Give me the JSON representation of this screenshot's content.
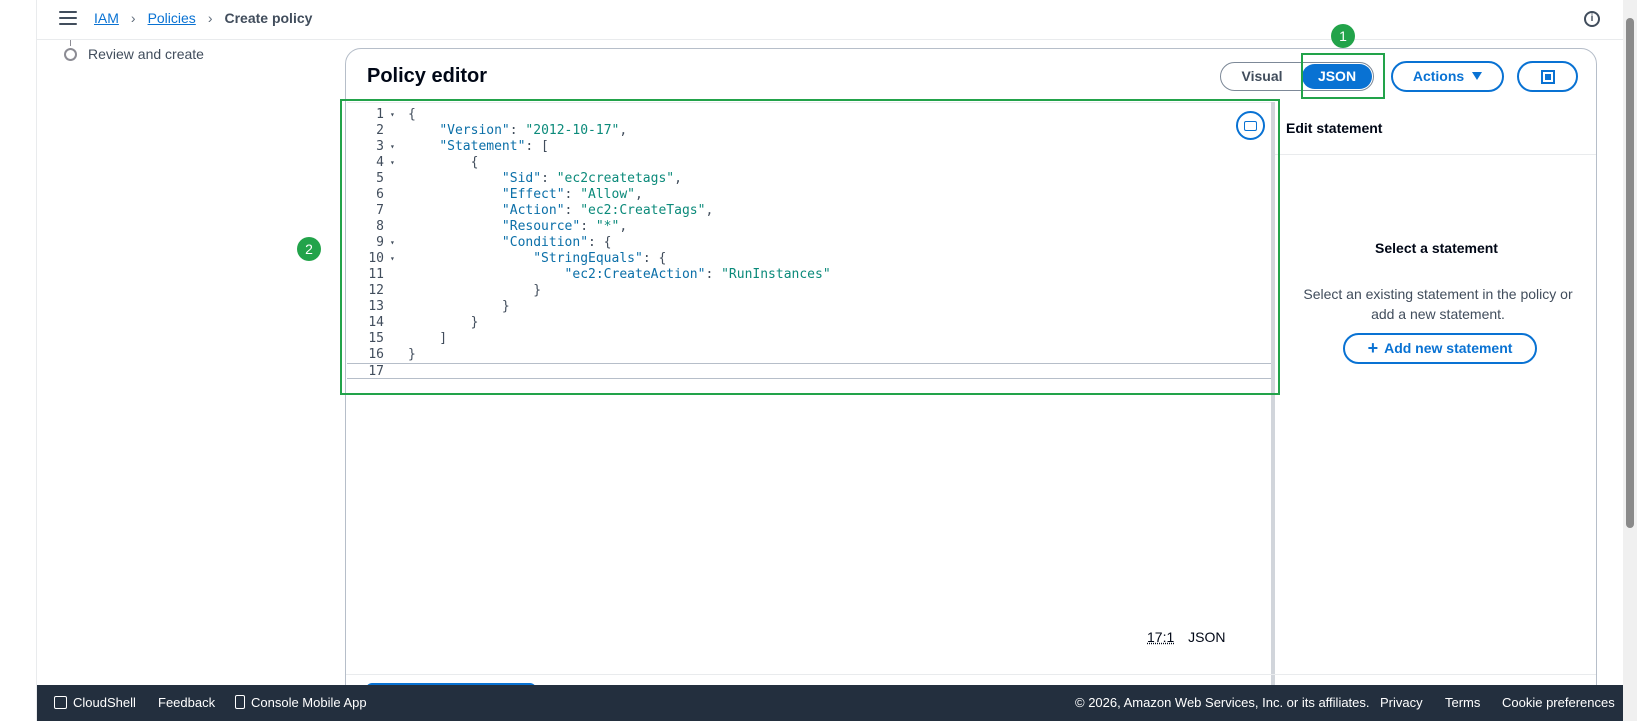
{
  "breadcrumb": {
    "items": [
      "IAM",
      "Policies"
    ],
    "current": "Create policy"
  },
  "wizard": {
    "step_label": "Review and create"
  },
  "editor_panel": {
    "title": "Policy editor",
    "toggle": {
      "visual": "Visual",
      "json": "JSON",
      "selected": "JSON"
    },
    "actions_label": "Actions",
    "status_position": "17:1",
    "status_mode": "JSON"
  },
  "code": [
    {
      "n": "1",
      "fold": true,
      "text": "{"
    },
    {
      "n": "2",
      "fold": false,
      "text": "    \"Version\": \"2012-10-17\","
    },
    {
      "n": "3",
      "fold": true,
      "text": "    \"Statement\": ["
    },
    {
      "n": "4",
      "fold": true,
      "text": "        {"
    },
    {
      "n": "5",
      "fold": false,
      "text": "            \"Sid\": \"ec2createtags\","
    },
    {
      "n": "6",
      "fold": false,
      "text": "            \"Effect\": \"Allow\","
    },
    {
      "n": "7",
      "fold": false,
      "text": "            \"Action\": \"ec2:CreateTags\","
    },
    {
      "n": "8",
      "fold": false,
      "text": "            \"Resource\": \"*\","
    },
    {
      "n": "9",
      "fold": true,
      "text": "            \"Condition\": {"
    },
    {
      "n": "10",
      "fold": true,
      "text": "                \"StringEquals\": {"
    },
    {
      "n": "11",
      "fold": false,
      "text": "                    \"ec2:CreateAction\": \"RunInstances\""
    },
    {
      "n": "12",
      "fold": false,
      "text": "                }"
    },
    {
      "n": "13",
      "fold": false,
      "text": "            }"
    },
    {
      "n": "14",
      "fold": false,
      "text": "        }"
    },
    {
      "n": "15",
      "fold": false,
      "text": "    ]"
    },
    {
      "n": "16",
      "fold": false,
      "text": "}"
    },
    {
      "n": "17",
      "fold": false,
      "text": ""
    }
  ],
  "statement_panel": {
    "title": "Edit statement",
    "empty_title": "Select a statement",
    "empty_desc": "Select an existing statement in the policy or add a new statement.",
    "add_button": "Add new statement"
  },
  "annotations": {
    "badge_1": "1",
    "badge_2": "2"
  },
  "footer": {
    "cloudshell": "CloudShell",
    "feedback": "Feedback",
    "mobile_app": "Console Mobile App",
    "copyright": "© 2026, Amazon Web Services, Inc. or its affiliates.",
    "privacy": "Privacy",
    "terms": "Terms",
    "cookie": "Cookie preferences"
  },
  "colors": {
    "accent": "#0972d3",
    "annotation": "#22a34a",
    "footer_bg": "#232f3e"
  }
}
